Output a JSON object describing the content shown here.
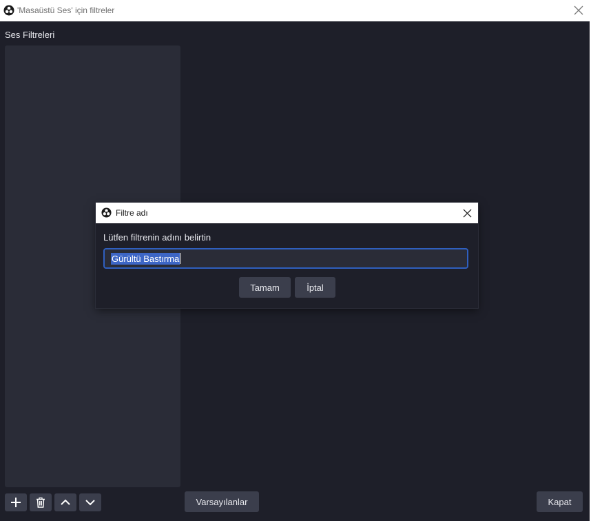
{
  "window": {
    "title": "'Masaüstü Ses' için filtreler",
    "app_icon": "obs-logo-icon",
    "close_icon": "close-icon"
  },
  "audio_filters": {
    "label": "Ses Filtreleri",
    "items": []
  },
  "toolbar": {
    "add_icon": "plus-icon",
    "remove_icon": "trash-icon",
    "move_up_icon": "chevron-up-icon",
    "move_down_icon": "chevron-down-icon",
    "defaults_label": "Varsayılanlar",
    "close_label": "Kapat"
  },
  "dialog": {
    "title": "Filtre adı",
    "prompt": "Lütfen filtrenin adını belirtin",
    "input_value": "Gürültü Bastırma",
    "ok_label": "Tamam",
    "cancel_label": "İptal"
  },
  "colors": {
    "background": "#1e1f29",
    "panel": "#2a2c37",
    "button": "#3b3e4c",
    "focus_border": "#2f5fbf",
    "selection": "#3d66c6"
  }
}
